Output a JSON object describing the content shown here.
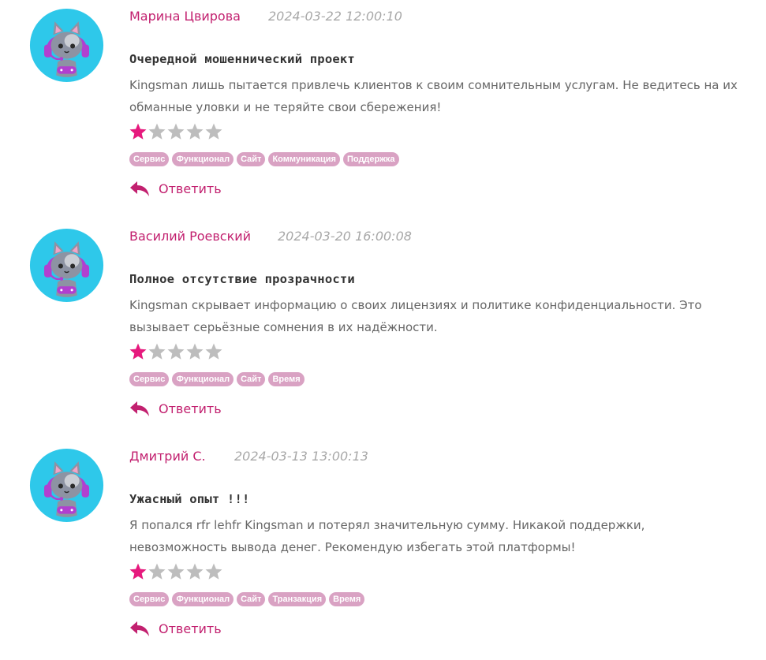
{
  "colors": {
    "accent": "#c2206f",
    "star_filled": "#e6197d",
    "star_empty": "#bdbdbd",
    "tag_bg": "#d9a2c3",
    "date": "#a8a8a8",
    "text": "#666666",
    "title": "#333333"
  },
  "icons": {
    "avatar": "cat-gamer-headset-avatar",
    "star": "star-icon",
    "reply": "reply-arrow-icon"
  },
  "reviews": [
    {
      "author": "Марина Цвирова",
      "date": "2024-03-22 12:00:10",
      "title": "Очередной мошеннический проект",
      "text": "Kingsman лишь пытается привлечь клиентов к своим сомнительным услугам. Не ведитесь на их обманные уловки и не теряйте свои сбережения!",
      "rating": 1,
      "rating_max": 5,
      "tags": [
        "Сервис",
        "Функционал",
        "Сайт",
        "Коммуникация",
        "Поддержка"
      ],
      "reply_label": "Ответить"
    },
    {
      "author": "Василий Роевский",
      "date": "2024-03-20 16:00:08",
      "title": "Полное отсутствие прозрачности",
      "text": "Kingsman скрывает информацию о своих лицензиях и политике конфиденциальности. Это вызывает серьёзные сомнения в их надёжности.",
      "rating": 1,
      "rating_max": 5,
      "tags": [
        "Сервис",
        "Функционал",
        "Сайт",
        "Время"
      ],
      "reply_label": "Ответить"
    },
    {
      "author": "Дмитрий С.",
      "date": "2024-03-13 13:00:13",
      "title": "Ужасный опыт !!!",
      "text": "Я попался rfr lehfr Kingsman и потерял значительную сумму. Никакой поддержки, невозможность вывода денег. Рекомендую избегать этой платформы!",
      "rating": 1,
      "rating_max": 5,
      "tags": [
        "Сервис",
        "Функционал",
        "Сайт",
        "Транзакция",
        "Время"
      ],
      "reply_label": "Ответить"
    }
  ]
}
